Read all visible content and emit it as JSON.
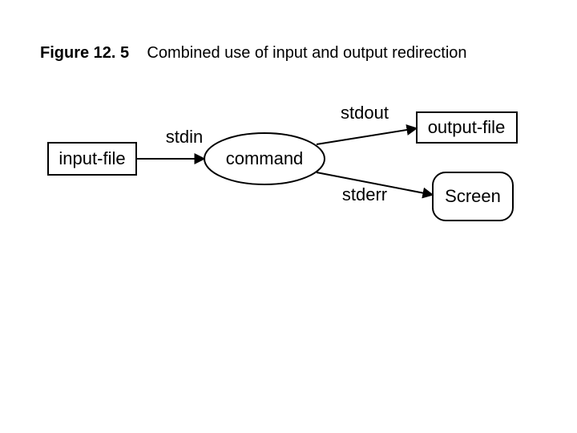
{
  "caption": {
    "prefix": "Figure 12. 5",
    "text": "Combined use of input and output redirection"
  },
  "nodes": {
    "input_file": "input-file",
    "command": "command",
    "output_file": "output-file",
    "screen": "Screen"
  },
  "edges": {
    "stdin": "stdin",
    "stdout": "stdout",
    "stderr": "stderr"
  }
}
